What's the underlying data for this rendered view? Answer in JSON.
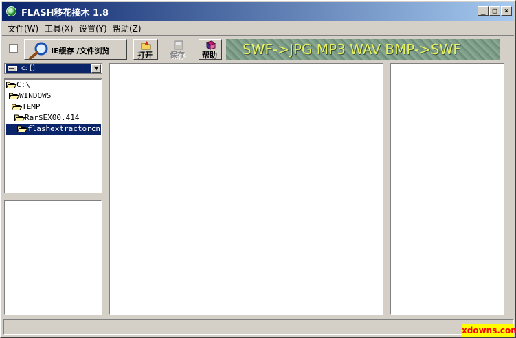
{
  "window": {
    "title": "FLASH移花接木 1.8",
    "controls": {
      "minimize": "_",
      "maximize": "□",
      "close": "×"
    }
  },
  "menu": [
    {
      "label": "文件(W)"
    },
    {
      "label": "工具(X)"
    },
    {
      "label": "设置(Y)"
    },
    {
      "label": "帮助(Z)"
    }
  ],
  "toolbar": {
    "ie_cache_label": "IE缓存 /文件浏览",
    "open_label": "打开",
    "save_label": "保存",
    "help_label": "帮助",
    "banner_text": "SWF->JPG MP3 WAV BMP->SWF"
  },
  "drive": {
    "selected": "c: []"
  },
  "tree": [
    {
      "label": "C:\\",
      "selected": false
    },
    {
      "label": "WINDOWS",
      "selected": false
    },
    {
      "label": "TEMP",
      "selected": false
    },
    {
      "label": "Rar$EX00.414",
      "selected": false
    },
    {
      "label": "flashextractorcn",
      "selected": true
    }
  ],
  "watermark": "xdowns.com",
  "colors": {
    "title_start": "#0a246a",
    "title_end": "#a6caf0",
    "selection": "#0a246a",
    "face": "#d4d0c8"
  }
}
